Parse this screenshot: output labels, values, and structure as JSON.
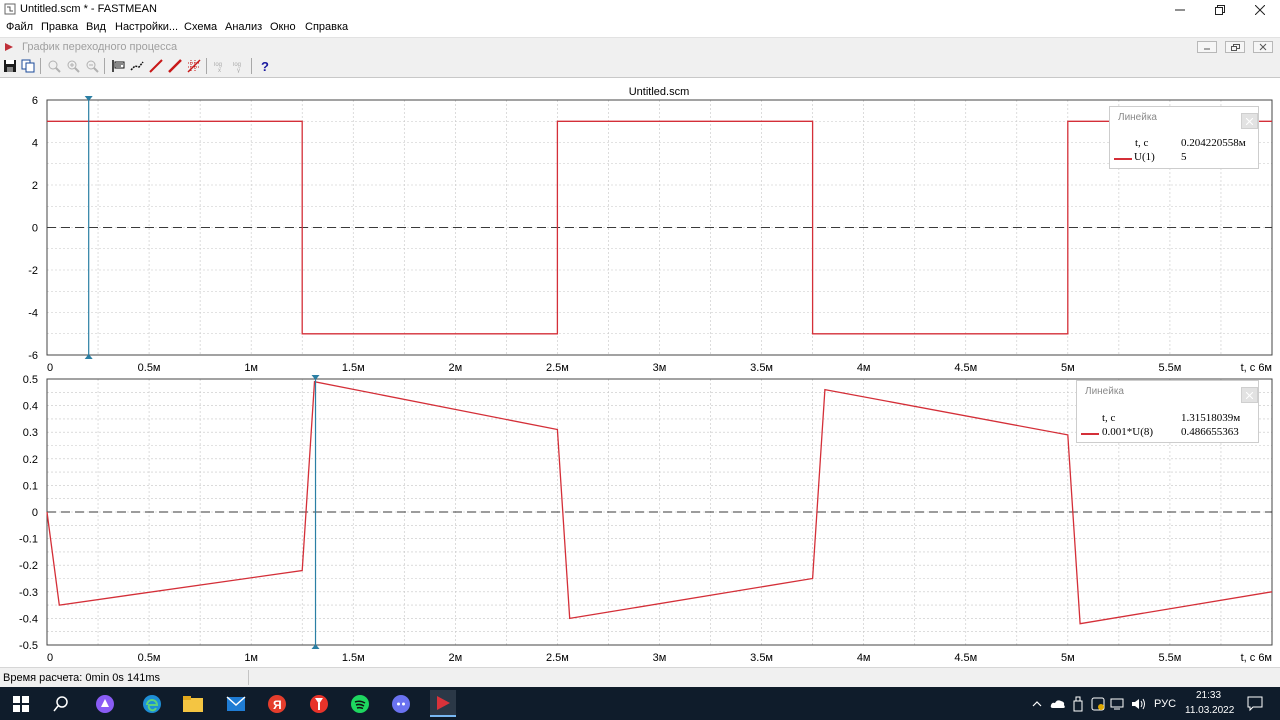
{
  "window": {
    "title": "Untitled.scm * - FASTMEAN",
    "controls": [
      "minimize",
      "maximize",
      "close"
    ]
  },
  "menu": [
    "Файл",
    "Правка",
    "Вид",
    "Настройки...",
    "Схема",
    "Анализ",
    "Окно",
    "Справка"
  ],
  "child_window": {
    "title": "График переходного процесса"
  },
  "chart_title": "Untitled.scm",
  "status": {
    "calc_time": "Время расчета: 0min 0s 141ms"
  },
  "colors": {
    "trace": "#d42f38",
    "cursor": "#2b7fa4",
    "title": "#27307a",
    "grid": "#c6c6c6",
    "zero_line": "#3a3a3a"
  },
  "x_tick_labels": [
    "0",
    "0.5м",
    "1м",
    "1.5м",
    "2м",
    "2.5м",
    "3м",
    "3.5м",
    "4м",
    "4.5м",
    "5м",
    "5.5м",
    "t, c 6м"
  ],
  "legend_top": {
    "title": "Линейка",
    "time_label": "t, c",
    "time_value": "0.204220558м",
    "series_label": "U(1)",
    "series_value": "5"
  },
  "legend_bottom": {
    "title": "Линейка",
    "time_label": "t, c",
    "time_value": "1.31518039м",
    "series_label": "0.001*U(8)",
    "series_value": "0.486655363"
  },
  "tray": {
    "lang": "РУС",
    "time": "21:33",
    "date": "11.03.2022"
  },
  "chart_data": [
    {
      "type": "line",
      "title": "Untitled.scm",
      "xlabel": "t, c",
      "xlim": [
        0,
        6
      ],
      "x_unit": "ms",
      "ylim": [
        -6,
        6
      ],
      "y_ticks": [
        6,
        4,
        2,
        0,
        -2,
        -4,
        -6
      ],
      "grid": true,
      "cursor_x": 0.204220558,
      "series": [
        {
          "name": "U(1)",
          "x": [
            0,
            1.25,
            1.25,
            2.5,
            2.5,
            3.75,
            3.75,
            5.0,
            5.0,
            6.0
          ],
          "y": [
            5,
            5,
            -5,
            -5,
            5,
            5,
            -5,
            -5,
            5,
            5
          ]
        }
      ]
    },
    {
      "type": "line",
      "xlabel": "t, c",
      "xlim": [
        0,
        6
      ],
      "x_unit": "ms",
      "ylim": [
        -0.5,
        0.5
      ],
      "y_ticks": [
        0.5,
        0.4,
        0.3,
        0.2,
        0.1,
        0,
        -0.1,
        -0.2,
        -0.3,
        -0.4,
        -0.5
      ],
      "grid": true,
      "cursor_x": 1.31518039,
      "series": [
        {
          "name": "0.001*U(8)",
          "x": [
            0,
            0.06,
            1.25,
            1.31,
            2.5,
            2.56,
            3.75,
            3.81,
            5.0,
            5.06,
            6.0
          ],
          "y": [
            0,
            -0.35,
            -0.22,
            0.49,
            0.31,
            -0.4,
            -0.25,
            0.46,
            0.29,
            -0.42,
            -0.3
          ]
        }
      ]
    }
  ]
}
